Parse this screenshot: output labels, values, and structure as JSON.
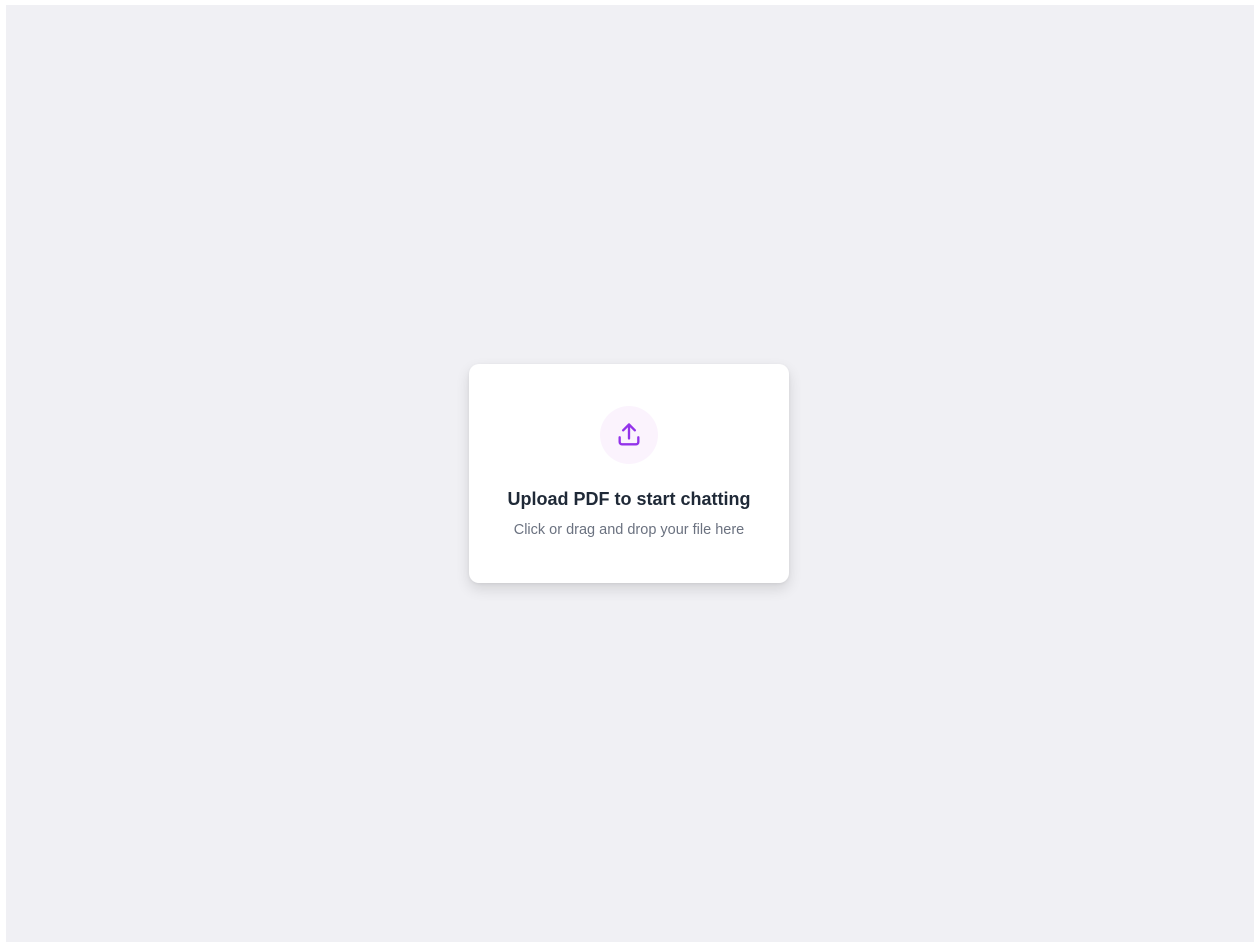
{
  "upload": {
    "icon": "upload-icon",
    "title": "Upload PDF to start chatting",
    "subtitle": "Click or drag and drop your file here"
  },
  "colors": {
    "background": "#f0f0f4",
    "card": "#ffffff",
    "accent": "#9333ea",
    "icon_bg": "#fbf3fd",
    "title": "#1f2937",
    "subtitle": "#6b7280"
  }
}
